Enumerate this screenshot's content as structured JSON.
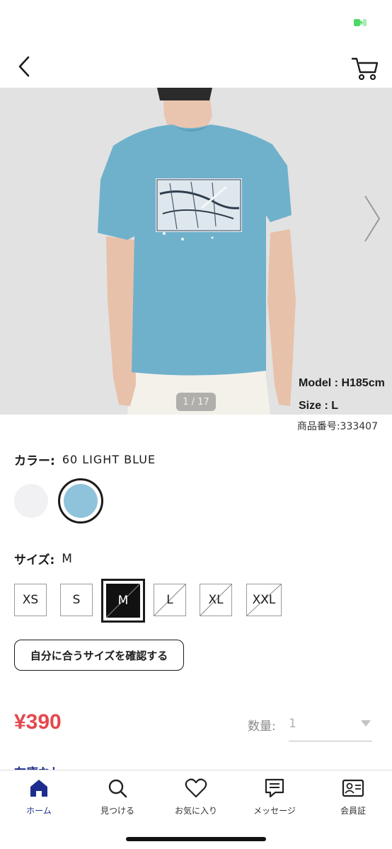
{
  "status_bar": {
    "battery_color": "#4cd964"
  },
  "header": {
    "back_icon": "chevron-left-icon",
    "cart_icon": "cart-icon"
  },
  "product": {
    "image_counter": "1 / 17",
    "model_height": "Model : H185cm",
    "model_size": "Size : L",
    "product_code": "商品番号:333407",
    "shirt_color": "#6fb1cb"
  },
  "color": {
    "label": "カラー:",
    "value": "60 LIGHT BLUE",
    "swatches": [
      {
        "name": "white",
        "hex": "#f1f1f3",
        "selected": false
      },
      {
        "name": "light-blue",
        "hex": "#8fc3dc",
        "selected": true
      }
    ]
  },
  "size": {
    "label": "サイズ:",
    "value": "M",
    "options": [
      {
        "label": "XS",
        "available": true,
        "selected": false
      },
      {
        "label": "S",
        "available": true,
        "selected": false
      },
      {
        "label": "M",
        "available": true,
        "selected": true
      },
      {
        "label": "L",
        "available": false,
        "selected": false
      },
      {
        "label": "XL",
        "available": false,
        "selected": false
      },
      {
        "label": "XXL",
        "available": false,
        "selected": false
      }
    ],
    "fit_button": "自分に合うサイズを確認する"
  },
  "price": {
    "value": "¥390",
    "color": "#e5484d"
  },
  "quantity": {
    "label": "数量:",
    "value": "1"
  },
  "stock_text": "在庫なし",
  "nav": {
    "items": [
      {
        "label": "ホーム",
        "icon": "home-icon",
        "active": true
      },
      {
        "label": "見つける",
        "icon": "search-icon",
        "active": false
      },
      {
        "label": "お気に入り",
        "icon": "heart-icon",
        "active": false
      },
      {
        "label": "メッセージ",
        "icon": "message-icon",
        "active": false
      },
      {
        "label": "会員証",
        "icon": "member-card-icon",
        "active": false
      }
    ],
    "active_color": "#1d2d8f"
  }
}
